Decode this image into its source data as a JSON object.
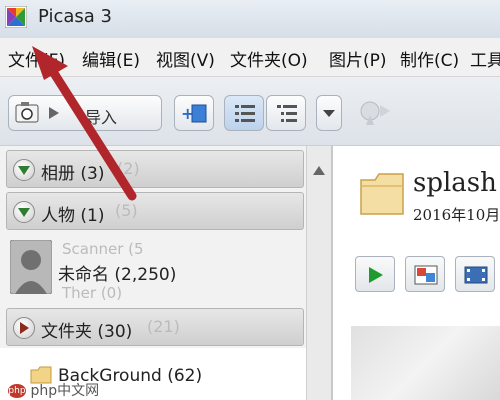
{
  "window": {
    "title": "Picasa 3"
  },
  "menu": [
    "文件(F)",
    "编辑(E)",
    "视图(V)",
    "文件夹(O)",
    "图片(P)",
    "制作(C)",
    "工具"
  ],
  "toolbar": {
    "import_label": "导入"
  },
  "left_panel": {
    "groups": [
      {
        "label": "相册 (3)",
        "ghost": "(2)"
      },
      {
        "label": "人物 (1)",
        "ghost": "(5)"
      },
      {
        "label": "文件夹 (30)",
        "ghost": "(21)"
      }
    ],
    "person": {
      "label": "未命名 (2,250)",
      "ghost_lines": [
        "Scanner (5",
        "Ther (0)"
      ]
    },
    "folder": {
      "label": "BackGround (62)"
    }
  },
  "right_panel": {
    "album_title": "splash",
    "album_date": "2016年10月"
  },
  "watermark": "php中文网",
  "colors": {
    "arrow": "#b0262b",
    "play": "#1e9b2c"
  }
}
